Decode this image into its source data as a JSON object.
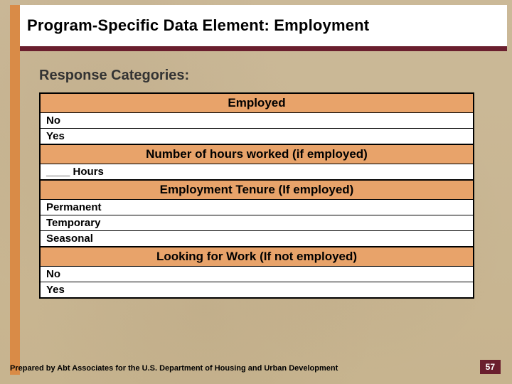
{
  "header": {
    "title": "Program-Specific Data Element: Employment"
  },
  "subtitle": "Response Categories:",
  "sections": [
    {
      "heading": "Employed",
      "rows": [
        "No",
        "Yes"
      ]
    },
    {
      "heading": "Number of hours worked (if employed)",
      "rows": [
        "____ Hours"
      ]
    },
    {
      "heading": "Employment Tenure (If employed)",
      "rows": [
        "Permanent",
        "Temporary",
        "Seasonal"
      ]
    },
    {
      "heading": "Looking for Work (If not employed)",
      "rows": [
        "No",
        "Yes"
      ]
    }
  ],
  "footer": "Prepared by Abt Associates for the U.S. Department of Housing and Urban Development",
  "page_number": "57"
}
